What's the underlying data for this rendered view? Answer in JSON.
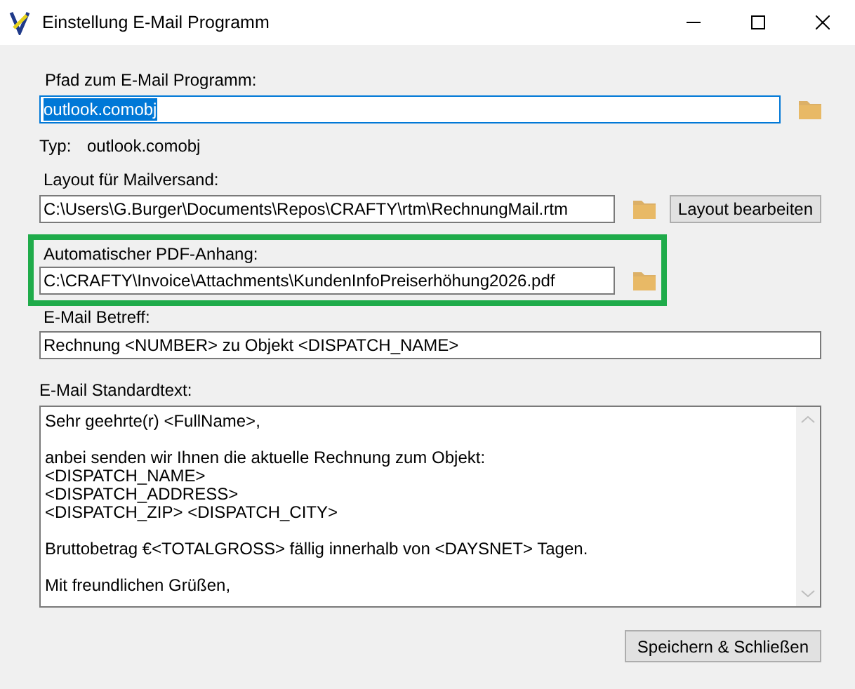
{
  "window": {
    "title": "Einstellung E-Mail Programm"
  },
  "program": {
    "label": "Pfad zum E-Mail Programm:",
    "value": "outlook.comobj",
    "text_selected": true,
    "type_label": "Typ:",
    "type_value": "outlook.comobj"
  },
  "layout": {
    "label": "Layout für Mailversand:",
    "value": "C:\\Users\\G.Burger\\Documents\\Repos\\CRAFTY\\rtm\\RechnungMail.rtm",
    "text_selected": false,
    "button": "Layout bearbeiten"
  },
  "attachment": {
    "label": "Automatischer PDF-Anhang:",
    "value": "C:\\CRAFTY\\Invoice\\Attachments\\KundenInfoPreiserhöhung2026.pdf",
    "text_selected": false,
    "highlighted": true
  },
  "subject": {
    "label": "E-Mail Betreff:",
    "value": "Rechnung <NUMBER> zu Objekt <DISPATCH_NAME>"
  },
  "body": {
    "label": "E-Mail Standardtext:",
    "value": "Sehr geehrte(r) <FullName>,\n\nanbei senden wir Ihnen die aktuelle Rechnung zum Objekt:\n<DISPATCH_NAME>\n<DISPATCH_ADDRESS>\n<DISPATCH_ZIP> <DISPATCH_CITY>\n\nBruttobetrag €<TOTALGROSS> fällig innerhalb von <DAYSNET> Tagen.\n\nMit freundlichen Grüßen,"
  },
  "buttons": [
    "Speichern & Schließen"
  ]
}
